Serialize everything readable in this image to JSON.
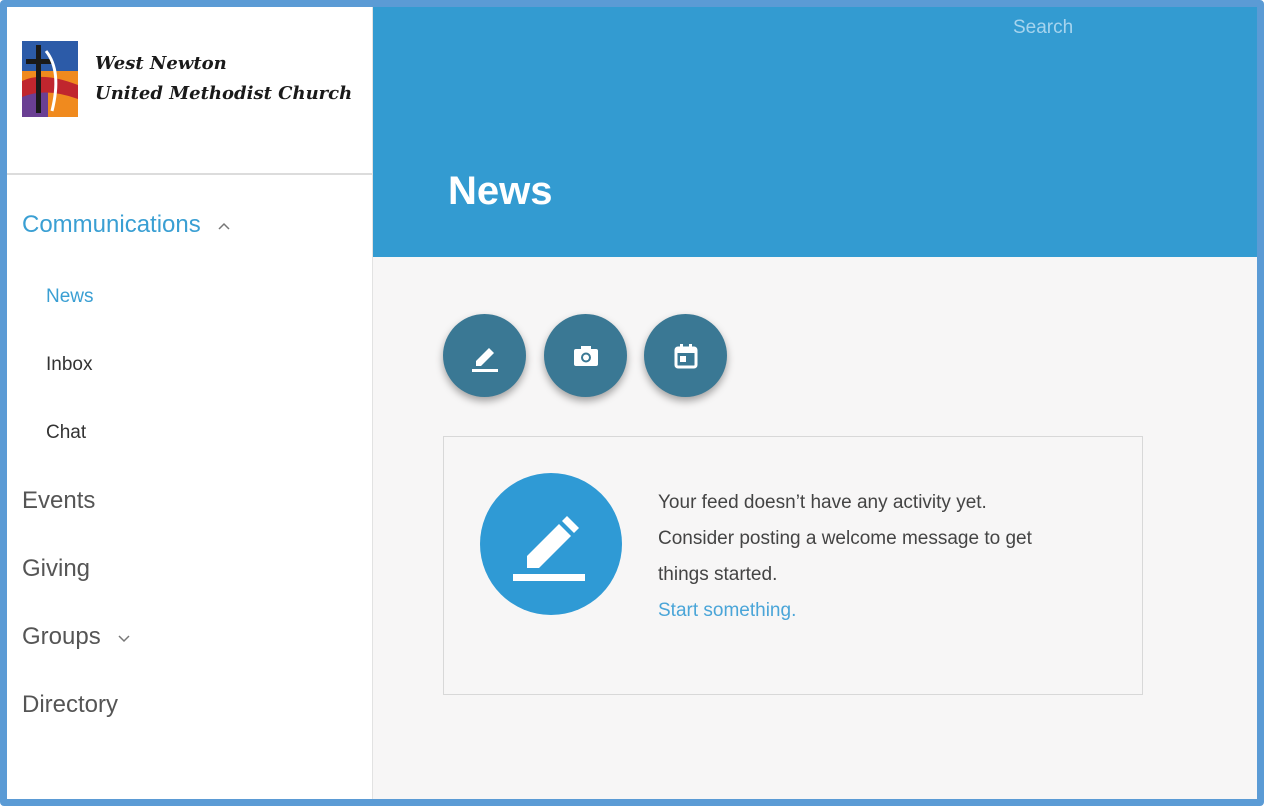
{
  "brand": {
    "line1": "West Newton",
    "line2": "United Methodist Church"
  },
  "nav": {
    "communications": "Communications",
    "sub": {
      "news": "News",
      "inbox": "Inbox",
      "chat": "Chat"
    },
    "events": "Events",
    "giving": "Giving",
    "groups": "Groups",
    "directory": "Directory"
  },
  "header": {
    "search": "Search",
    "title": "News"
  },
  "actions": {
    "icons": [
      "pencil-icon",
      "camera-icon",
      "calendar-icon"
    ]
  },
  "feed": {
    "line1": "Your feed doesn’t have any activity yet.",
    "line2": "Consider posting a welcome message to get",
    "line3": "things started.",
    "link": "Start something."
  },
  "colors": {
    "header_bg": "#339bd1",
    "accent": "#3a9fd3",
    "fab_bg": "#3a7894",
    "frame": "#5b9bd5"
  }
}
